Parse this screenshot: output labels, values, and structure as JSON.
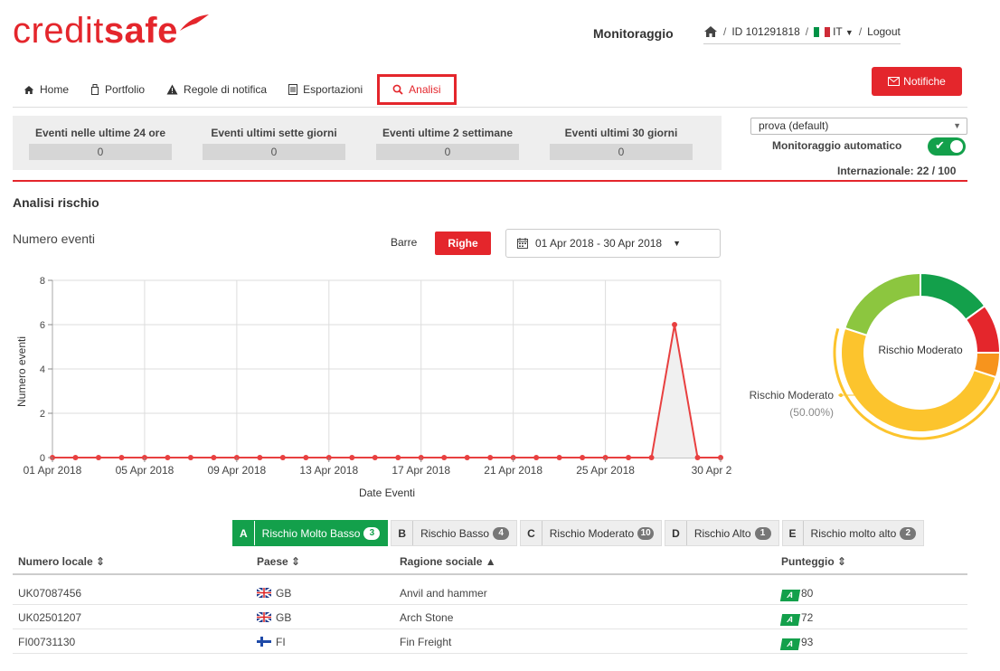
{
  "header": {
    "logo_part1": "credit",
    "logo_part2": "safe",
    "title": "Monitoraggio",
    "links": {
      "id": "ID 101291818",
      "lang": "IT",
      "logout": "Logout"
    }
  },
  "nav": {
    "home": "Home",
    "portfolio": "Portfolio",
    "rules": "Regole di notifica",
    "exports": "Esportazioni",
    "analysis": "Analisi",
    "notifications": "Notifiche"
  },
  "stats": [
    {
      "label": "Eventi nelle ultime 24 ore",
      "value": "0"
    },
    {
      "label": "Eventi ultimi sette giorni",
      "value": "0"
    },
    {
      "label": "Eventi ultime 2 settimane",
      "value": "0"
    },
    {
      "label": "Eventi ultimi 30 giorni",
      "value": "0"
    }
  ],
  "portfolio_select": "prova (default)",
  "auto_monitoring": {
    "label": "Monitoraggio automatico",
    "enabled": true
  },
  "international": "Internazionale: 22 / 100",
  "section_title": "Analisi rischio",
  "chart": {
    "title": "Numero eventi",
    "view_bars": "Barre",
    "view_lines": "Righe",
    "date_range": "01 Apr 2018 - 30 Apr 2018"
  },
  "chart_data": [
    {
      "type": "line",
      "title": "Numero eventi",
      "xlabel": "Date Eventi",
      "ylabel": "Numero eventi",
      "ylim": [
        0,
        8
      ],
      "yticks": [
        0,
        2,
        4,
        6,
        8
      ],
      "xtick_labels": [
        "01 Apr 2018",
        "05 Apr 2018",
        "09 Apr 2018",
        "13 Apr 2018",
        "17 Apr 2018",
        "21 Apr 2018",
        "25 Apr 2018",
        "30 Apr 2018"
      ],
      "x": [
        "01 Apr 2018",
        "02 Apr 2018",
        "03 Apr 2018",
        "04 Apr 2018",
        "05 Apr 2018",
        "06 Apr 2018",
        "07 Apr 2018",
        "08 Apr 2018",
        "09 Apr 2018",
        "10 Apr 2018",
        "11 Apr 2018",
        "12 Apr 2018",
        "13 Apr 2018",
        "14 Apr 2018",
        "15 Apr 2018",
        "16 Apr 2018",
        "17 Apr 2018",
        "18 Apr 2018",
        "19 Apr 2018",
        "20 Apr 2018",
        "21 Apr 2018",
        "22 Apr 2018",
        "23 Apr 2018",
        "24 Apr 2018",
        "25 Apr 2018",
        "26 Apr 2018",
        "27 Apr 2018",
        "28 Apr 2018",
        "29 Apr 2018",
        "30 Apr 2018"
      ],
      "values": [
        0,
        0,
        0,
        0,
        0,
        0,
        0,
        0,
        0,
        0,
        0,
        0,
        0,
        0,
        0,
        0,
        0,
        0,
        0,
        0,
        0,
        0,
        0,
        0,
        0,
        0,
        0,
        6,
        0,
        0
      ],
      "color": "#e84040",
      "grid": true
    },
    {
      "type": "pie",
      "subtype": "donut",
      "center_label": "Rischio Moderato",
      "highlight": {
        "label": "Rischio Moderato",
        "percent": "(50.00%)"
      },
      "slices": [
        {
          "category": "A",
          "value": 3,
          "color": "#13a04b"
        },
        {
          "category": "E",
          "value": 2,
          "color": "#e4262c"
        },
        {
          "category": "D",
          "value": 1,
          "color": "#f7941d"
        },
        {
          "category": "C",
          "value": 10,
          "color": "#fcc42d"
        },
        {
          "category": "B",
          "value": 4,
          "color": "#8cc63f"
        }
      ]
    }
  ],
  "risk_tabs": [
    {
      "key": "A",
      "label": "Rischio Molto Basso",
      "count": "3",
      "active": true
    },
    {
      "key": "B",
      "label": "Rischio Basso",
      "count": "4",
      "active": false
    },
    {
      "key": "C",
      "label": "Rischio Moderato",
      "count": "10",
      "active": false
    },
    {
      "key": "D",
      "label": "Rischio Alto",
      "count": "1",
      "active": false
    },
    {
      "key": "E",
      "label": "Rischio molto alto",
      "count": "2",
      "active": false
    }
  ],
  "table": {
    "headers": {
      "number": "Numero locale ⇕",
      "country": "Paese ⇕",
      "name": "Ragione sociale ▲",
      "score": "Punteggio ⇕"
    },
    "rows": [
      {
        "number": "UK07087456",
        "country": "GB",
        "name": "Anvil and hammer",
        "grade": "A",
        "score": "80"
      },
      {
        "number": "UK02501207",
        "country": "GB",
        "name": "Arch Stone",
        "grade": "A",
        "score": "72"
      },
      {
        "number": "FI00731130",
        "country": "FI",
        "name": "Fin Freight",
        "grade": "A",
        "score": "93"
      }
    ]
  },
  "colors": {
    "brand": "#e4262c",
    "green": "#13a04b"
  }
}
